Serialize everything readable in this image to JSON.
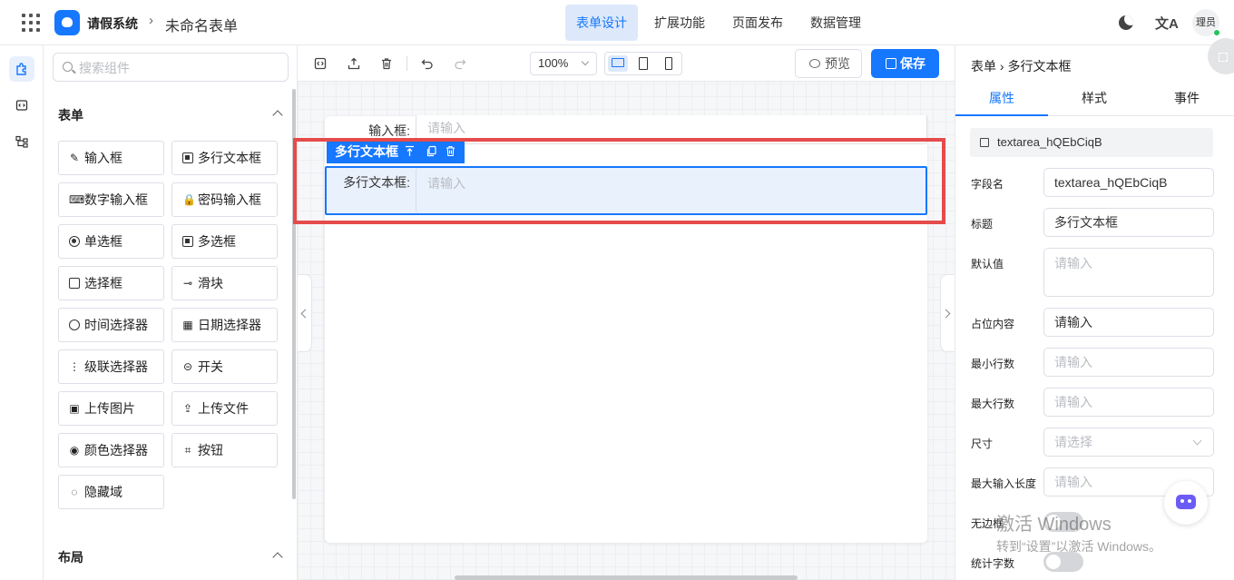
{
  "app": {
    "name": "请假系统",
    "breadcrumb_sep": "›",
    "document_title": "未命名表单",
    "nav": [
      "表单设计",
      "扩展功能",
      "页面发布",
      "数据管理"
    ],
    "active_nav": "表单设计",
    "avatar_text": "理员",
    "translate_glyph": "文A"
  },
  "components": {
    "search_placeholder": "搜索组件",
    "form_section": "表单",
    "items": [
      {
        "label": "输入框",
        "icon": "pencil-icon",
        "glyph": "✎"
      },
      {
        "label": "多行文本框",
        "icon": "textarea-icon",
        "glyph": ""
      },
      {
        "label": "数字输入框",
        "icon": "number-icon",
        "glyph": "⌨"
      },
      {
        "label": "密码输入框",
        "icon": "lock-icon",
        "glyph": "🔒"
      },
      {
        "label": "单选框",
        "icon": "radio-icon",
        "glyph": ""
      },
      {
        "label": "多选框",
        "icon": "checkbox-icon",
        "glyph": ""
      },
      {
        "label": "选择框",
        "icon": "select-icon",
        "glyph": ""
      },
      {
        "label": "滑块",
        "icon": "slider-icon",
        "glyph": "⊸"
      },
      {
        "label": "时间选择器",
        "icon": "clock-icon",
        "glyph": ""
      },
      {
        "label": "日期选择器",
        "icon": "calendar-icon",
        "glyph": "▦"
      },
      {
        "label": "级联选择器",
        "icon": "cascader-icon",
        "glyph": "⋮"
      },
      {
        "label": "开关",
        "icon": "switch-icon",
        "glyph": "⊝"
      },
      {
        "label": "上传图片",
        "icon": "image-icon",
        "glyph": "▣"
      },
      {
        "label": "上传文件",
        "icon": "upload-icon",
        "glyph": "⇪"
      },
      {
        "label": "颜色选择器",
        "icon": "palette-icon",
        "glyph": "◉"
      },
      {
        "label": "按钮",
        "icon": "button-icon",
        "glyph": "⌗"
      },
      {
        "label": "隐藏域",
        "icon": "eye-off-icon",
        "glyph": "◌"
      }
    ],
    "layout_section": "布局"
  },
  "toolbar": {
    "zoom": "100%",
    "preview": "预览",
    "save": "保存"
  },
  "canvas": {
    "field1_label": "输入框:",
    "field1_placeholder": "请输入",
    "selected_toolbar_label": "多行文本框",
    "field2_label": "多行文本框:",
    "field2_placeholder": "请输入"
  },
  "properties": {
    "breadcrumb_root": "表单",
    "breadcrumb_current": "多行文本框",
    "tabs": [
      "属性",
      "样式",
      "事件"
    ],
    "active_tab": "属性",
    "component_id": "textarea_hQEbCiqB",
    "rows": {
      "field_name": {
        "label": "字段名",
        "value": "textarea_hQEbCiqB"
      },
      "title": {
        "label": "标题",
        "value": "多行文本框"
      },
      "default": {
        "label": "默认值",
        "placeholder": "请输入"
      },
      "placeholder": {
        "label": "占位内容",
        "value": "请输入"
      },
      "min_rows": {
        "label": "最小行数",
        "placeholder": "请输入"
      },
      "max_rows": {
        "label": "最大行数",
        "placeholder": "请输入"
      },
      "size": {
        "label": "尺寸",
        "placeholder": "请选择"
      },
      "max_length": {
        "label": "最大输入长度",
        "placeholder": "请输入"
      },
      "no_border": {
        "label": "无边框",
        "on": false
      },
      "word_count": {
        "label": "统计字数",
        "on": false
      }
    }
  },
  "watermark": {
    "line1": "激活 Windows",
    "line2": "转到“设置”以激活 Windows。"
  },
  "colors": {
    "accent": "#1677ff",
    "selection_outline": "#e54b4b"
  }
}
